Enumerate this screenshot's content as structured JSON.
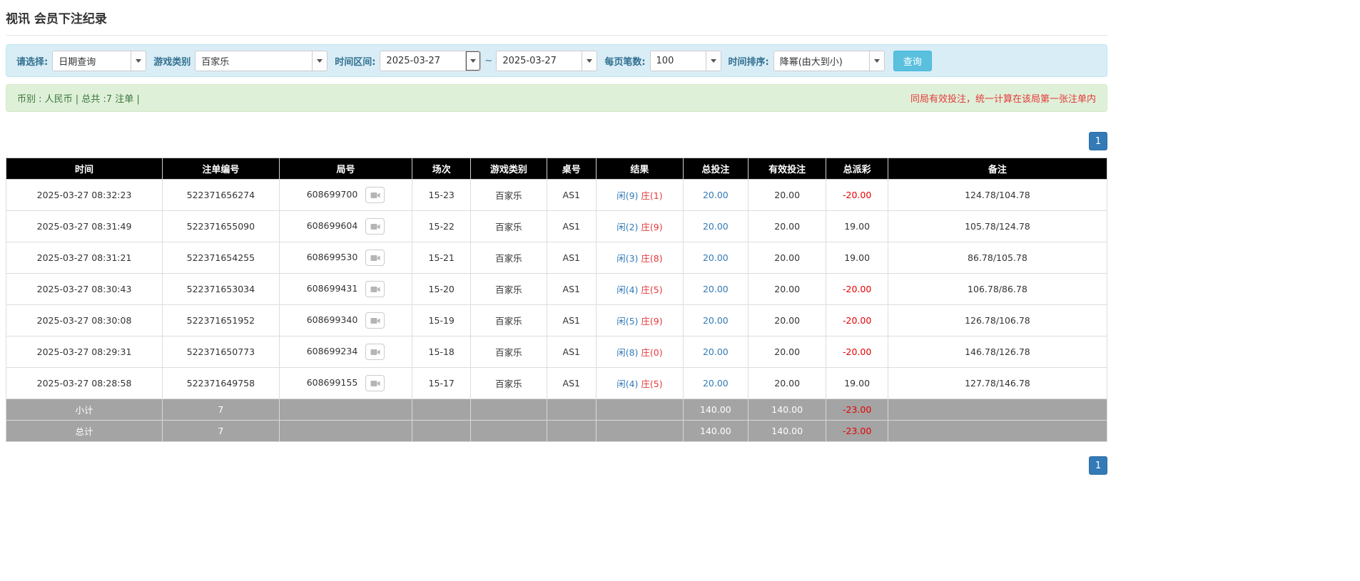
{
  "page": {
    "title": "视讯 会员下注纪录"
  },
  "filters": {
    "select_label": "请选择:",
    "select_value": "日期查询",
    "game_type_label": "游戏类别",
    "game_type_value": "百家乐",
    "time_range_label": "时间区间:",
    "date_from": "2025-03-27",
    "date_separator": "~",
    "date_to": "2025-03-27",
    "page_size_label": "每页笔数:",
    "page_size_value": "100",
    "sort_label": "时间排序:",
    "sort_value": "降幂(由大到小)",
    "search_button": "查询"
  },
  "summary_bar": {
    "left": "币别 : 人民币 | 总共 :7 注单 |",
    "right": "同局有效投注，统一计算在该局第一张注单内"
  },
  "pagination": {
    "page": "1"
  },
  "table": {
    "headers": [
      "时间",
      "注单编号",
      "局号",
      "场次",
      "游戏类别",
      "桌号",
      "结果",
      "总投注",
      "有效投注",
      "总派彩",
      "备注"
    ],
    "rows": [
      {
        "time": "2025-03-27 08:32:23",
        "bet_id": "522371656274",
        "round_id": "608699700",
        "session": "15-23",
        "game": "百家乐",
        "table_no": "AS1",
        "result_player": "闲(9)",
        "result_banker": "庄(1)",
        "total_bet": "20.00",
        "valid_bet": "20.00",
        "payout": "-20.00",
        "note": "124.78/104.78"
      },
      {
        "time": "2025-03-27 08:31:49",
        "bet_id": "522371655090",
        "round_id": "608699604",
        "session": "15-22",
        "game": "百家乐",
        "table_no": "AS1",
        "result_player": "闲(2)",
        "result_banker": "庄(9)",
        "total_bet": "20.00",
        "valid_bet": "20.00",
        "payout": "19.00",
        "note": "105.78/124.78"
      },
      {
        "time": "2025-03-27 08:31:21",
        "bet_id": "522371654255",
        "round_id": "608699530",
        "session": "15-21",
        "game": "百家乐",
        "table_no": "AS1",
        "result_player": "闲(3)",
        "result_banker": "庄(8)",
        "total_bet": "20.00",
        "valid_bet": "20.00",
        "payout": "19.00",
        "note": "86.78/105.78"
      },
      {
        "time": "2025-03-27 08:30:43",
        "bet_id": "522371653034",
        "round_id": "608699431",
        "session": "15-20",
        "game": "百家乐",
        "table_no": "AS1",
        "result_player": "闲(4)",
        "result_banker": "庄(5)",
        "total_bet": "20.00",
        "valid_bet": "20.00",
        "payout": "-20.00",
        "note": "106.78/86.78"
      },
      {
        "time": "2025-03-27 08:30:08",
        "bet_id": "522371651952",
        "round_id": "608699340",
        "session": "15-19",
        "game": "百家乐",
        "table_no": "AS1",
        "result_player": "闲(5)",
        "result_banker": "庄(9)",
        "total_bet": "20.00",
        "valid_bet": "20.00",
        "payout": "-20.00",
        "note": "126.78/106.78"
      },
      {
        "time": "2025-03-27 08:29:31",
        "bet_id": "522371650773",
        "round_id": "608699234",
        "session": "15-18",
        "game": "百家乐",
        "table_no": "AS1",
        "result_player": "闲(8)",
        "result_banker": "庄(0)",
        "total_bet": "20.00",
        "valid_bet": "20.00",
        "payout": "-20.00",
        "note": "146.78/126.78"
      },
      {
        "time": "2025-03-27 08:28:58",
        "bet_id": "522371649758",
        "round_id": "608699155",
        "session": "15-17",
        "game": "百家乐",
        "table_no": "AS1",
        "result_player": "闲(4)",
        "result_banker": "庄(5)",
        "total_bet": "20.00",
        "valid_bet": "20.00",
        "payout": "19.00",
        "note": "127.78/146.78"
      }
    ],
    "subtotal": {
      "label": "小计",
      "count": "7",
      "total_bet": "140.00",
      "valid_bet": "140.00",
      "payout": "-23.00"
    },
    "total": {
      "label": "总计",
      "count": "7",
      "total_bet": "140.00",
      "valid_bet": "140.00",
      "payout": "-23.00"
    }
  }
}
